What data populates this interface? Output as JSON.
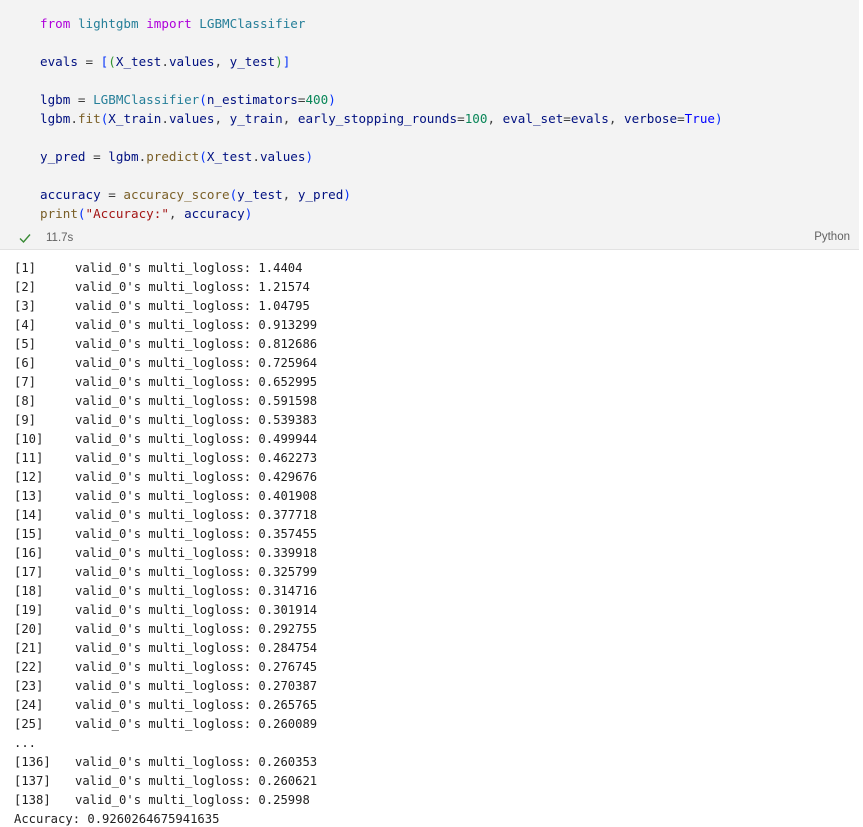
{
  "cell": {
    "code_lines": [
      [
        {
          "t": "from",
          "c": "kw"
        },
        {
          "t": " ",
          "c": "punc"
        },
        {
          "t": "lightgbm",
          "c": "mod"
        },
        {
          "t": " ",
          "c": "punc"
        },
        {
          "t": "import",
          "c": "kw"
        },
        {
          "t": " ",
          "c": "punc"
        },
        {
          "t": "LGBMClassifier",
          "c": "cls"
        }
      ],
      [],
      [
        {
          "t": "evals",
          "c": "var"
        },
        {
          "t": " = ",
          "c": "punc"
        },
        {
          "t": "[",
          "c": "paren1"
        },
        {
          "t": "(",
          "c": "paren2"
        },
        {
          "t": "X_test",
          "c": "var"
        },
        {
          "t": ".",
          "c": "punc"
        },
        {
          "t": "values",
          "c": "var"
        },
        {
          "t": ", ",
          "c": "punc"
        },
        {
          "t": "y_test",
          "c": "var"
        },
        {
          "t": ")",
          "c": "paren2"
        },
        {
          "t": "]",
          "c": "paren1"
        }
      ],
      [],
      [
        {
          "t": "lgbm",
          "c": "var"
        },
        {
          "t": " = ",
          "c": "punc"
        },
        {
          "t": "LGBMClassifier",
          "c": "cls"
        },
        {
          "t": "(",
          "c": "paren1"
        },
        {
          "t": "n_estimators",
          "c": "var"
        },
        {
          "t": "=",
          "c": "punc"
        },
        {
          "t": "400",
          "c": "num"
        },
        {
          "t": ")",
          "c": "paren1"
        }
      ],
      [
        {
          "t": "lgbm",
          "c": "var"
        },
        {
          "t": ".",
          "c": "punc"
        },
        {
          "t": "fit",
          "c": "fn"
        },
        {
          "t": "(",
          "c": "paren1"
        },
        {
          "t": "X_train",
          "c": "var"
        },
        {
          "t": ".",
          "c": "punc"
        },
        {
          "t": "values",
          "c": "var"
        },
        {
          "t": ", ",
          "c": "punc"
        },
        {
          "t": "y_train",
          "c": "var"
        },
        {
          "t": ", ",
          "c": "punc"
        },
        {
          "t": "early_stopping_rounds",
          "c": "var"
        },
        {
          "t": "=",
          "c": "punc"
        },
        {
          "t": "100",
          "c": "num"
        },
        {
          "t": ", ",
          "c": "punc"
        },
        {
          "t": "eval_set",
          "c": "var"
        },
        {
          "t": "=",
          "c": "punc"
        },
        {
          "t": "evals",
          "c": "var"
        },
        {
          "t": ", ",
          "c": "punc"
        },
        {
          "t": "verbose",
          "c": "var"
        },
        {
          "t": "=",
          "c": "punc"
        },
        {
          "t": "True",
          "c": "bool"
        },
        {
          "t": ")",
          "c": "paren1"
        }
      ],
      [],
      [
        {
          "t": "y_pred",
          "c": "var"
        },
        {
          "t": " = ",
          "c": "punc"
        },
        {
          "t": "lgbm",
          "c": "var"
        },
        {
          "t": ".",
          "c": "punc"
        },
        {
          "t": "predict",
          "c": "fn"
        },
        {
          "t": "(",
          "c": "paren1"
        },
        {
          "t": "X_test",
          "c": "var"
        },
        {
          "t": ".",
          "c": "punc"
        },
        {
          "t": "values",
          "c": "var"
        },
        {
          "t": ")",
          "c": "paren1"
        }
      ],
      [],
      [
        {
          "t": "accuracy",
          "c": "var"
        },
        {
          "t": " = ",
          "c": "punc"
        },
        {
          "t": "accuracy_score",
          "c": "fn"
        },
        {
          "t": "(",
          "c": "paren1"
        },
        {
          "t": "y_test",
          "c": "var"
        },
        {
          "t": ", ",
          "c": "punc"
        },
        {
          "t": "y_pred",
          "c": "var"
        },
        {
          "t": ")",
          "c": "paren1"
        }
      ],
      [
        {
          "t": "print",
          "c": "fn"
        },
        {
          "t": "(",
          "c": "paren1"
        },
        {
          "t": "\"Accuracy:\"",
          "c": "str"
        },
        {
          "t": ", ",
          "c": "punc"
        },
        {
          "t": "accuracy",
          "c": "var"
        },
        {
          "t": ")",
          "c": "paren1"
        }
      ]
    ],
    "execution_time": "11.7s",
    "language": "Python",
    "status_icon": "check-icon",
    "status_color": "#388a34"
  },
  "output": {
    "rows": [
      {
        "idx": "[1]",
        "text": "valid_0's multi_logloss: 1.4404"
      },
      {
        "idx": "[2]",
        "text": "valid_0's multi_logloss: 1.21574"
      },
      {
        "idx": "[3]",
        "text": "valid_0's multi_logloss: 1.04795"
      },
      {
        "idx": "[4]",
        "text": "valid_0's multi_logloss: 0.913299"
      },
      {
        "idx": "[5]",
        "text": "valid_0's multi_logloss: 0.812686"
      },
      {
        "idx": "[6]",
        "text": "valid_0's multi_logloss: 0.725964"
      },
      {
        "idx": "[7]",
        "text": "valid_0's multi_logloss: 0.652995"
      },
      {
        "idx": "[8]",
        "text": "valid_0's multi_logloss: 0.591598"
      },
      {
        "idx": "[9]",
        "text": "valid_0's multi_logloss: 0.539383"
      },
      {
        "idx": "[10]",
        "text": "valid_0's multi_logloss: 0.499944"
      },
      {
        "idx": "[11]",
        "text": "valid_0's multi_logloss: 0.462273"
      },
      {
        "idx": "[12]",
        "text": "valid_0's multi_logloss: 0.429676"
      },
      {
        "idx": "[13]",
        "text": "valid_0's multi_logloss: 0.401908"
      },
      {
        "idx": "[14]",
        "text": "valid_0's multi_logloss: 0.377718"
      },
      {
        "idx": "[15]",
        "text": "valid_0's multi_logloss: 0.357455"
      },
      {
        "idx": "[16]",
        "text": "valid_0's multi_logloss: 0.339918"
      },
      {
        "idx": "[17]",
        "text": "valid_0's multi_logloss: 0.325799"
      },
      {
        "idx": "[18]",
        "text": "valid_0's multi_logloss: 0.314716"
      },
      {
        "idx": "[19]",
        "text": "valid_0's multi_logloss: 0.301914"
      },
      {
        "idx": "[20]",
        "text": "valid_0's multi_logloss: 0.292755"
      },
      {
        "idx": "[21]",
        "text": "valid_0's multi_logloss: 0.284754"
      },
      {
        "idx": "[22]",
        "text": "valid_0's multi_logloss: 0.276745"
      },
      {
        "idx": "[23]",
        "text": "valid_0's multi_logloss: 0.270387"
      },
      {
        "idx": "[24]",
        "text": "valid_0's multi_logloss: 0.265765"
      },
      {
        "idx": "[25]",
        "text": "valid_0's multi_logloss: 0.260089"
      },
      {
        "idx": "...",
        "text": ""
      },
      {
        "idx": "[136]",
        "text": "valid_0's multi_logloss: 0.260353"
      },
      {
        "idx": "[137]",
        "text": "valid_0's multi_logloss: 0.260621"
      },
      {
        "idx": "[138]",
        "text": "valid_0's multi_logloss: 0.25998"
      }
    ],
    "final_line": "Accuracy: 0.9260264675941635"
  }
}
